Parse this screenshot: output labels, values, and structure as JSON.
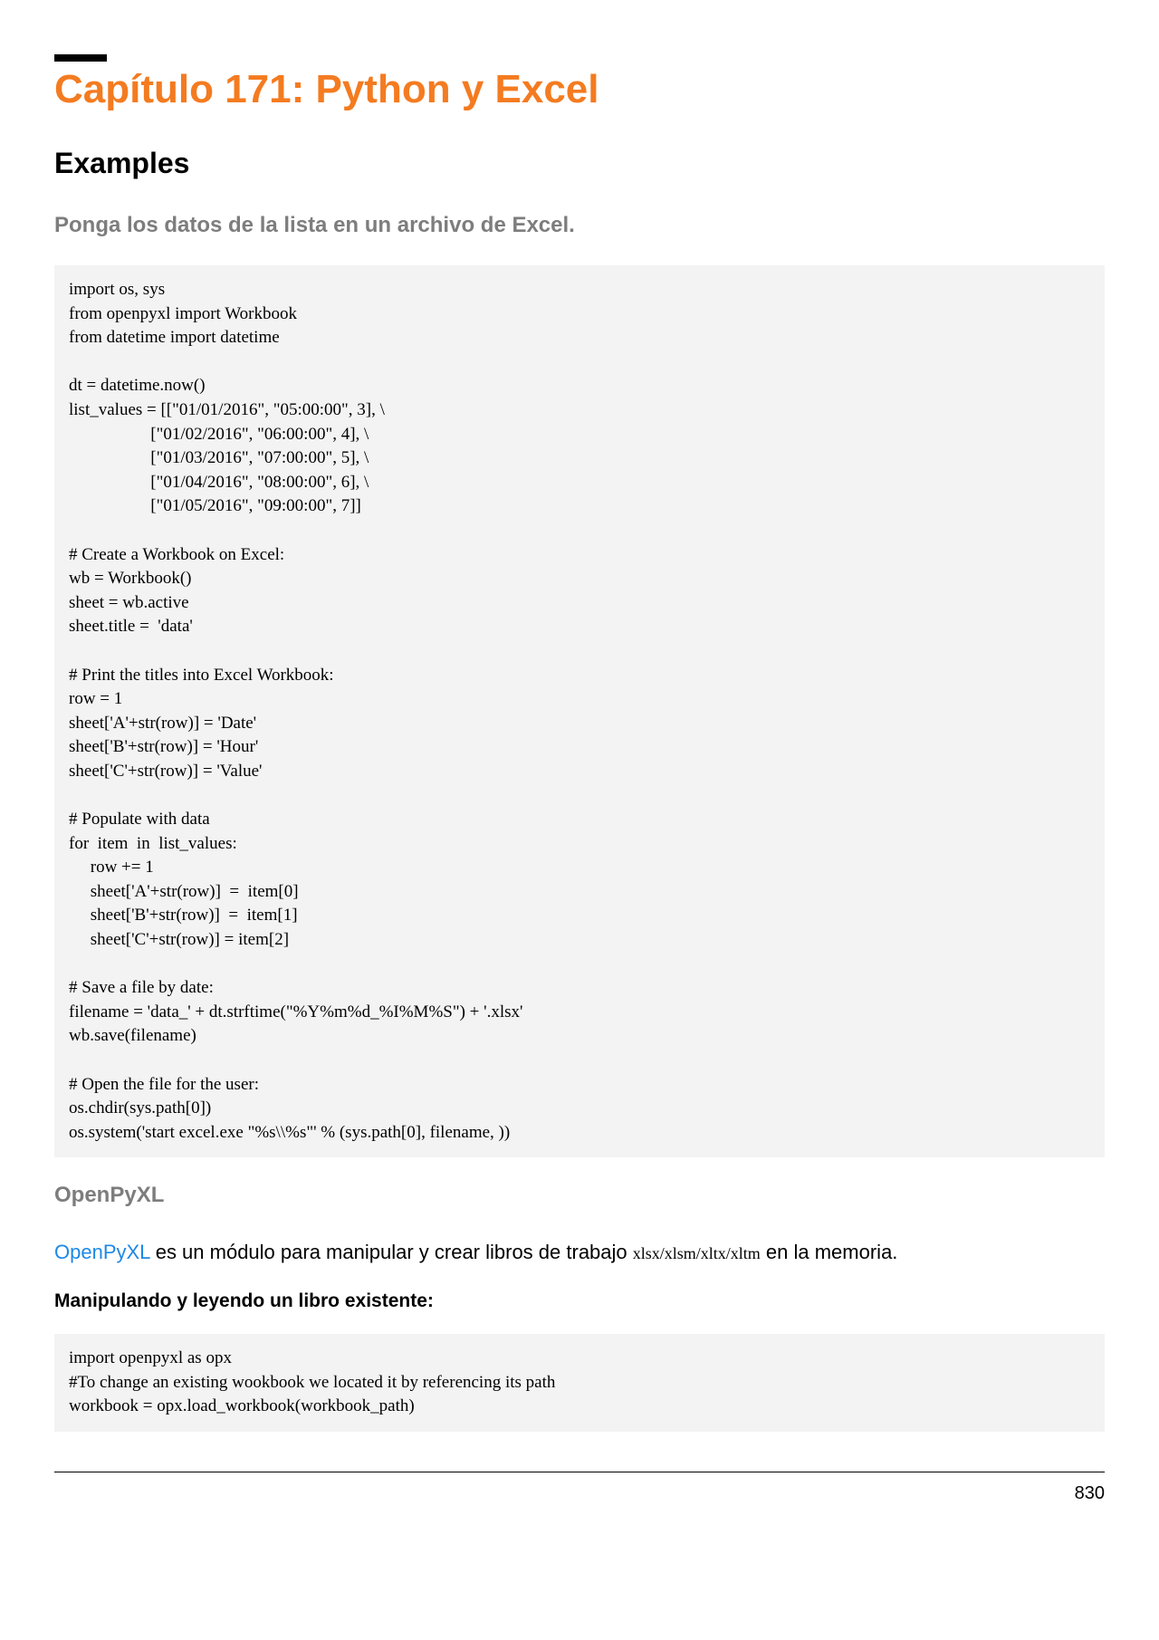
{
  "chapter": {
    "title": "Capítulo 171: Python y Excel"
  },
  "examples": {
    "heading": "Examples",
    "subtitle": "Ponga los datos de la lista en un archivo de Excel."
  },
  "code_block_1": "import os, sys\nfrom openpyxl import Workbook\nfrom datetime import datetime\n\ndt = datetime.now()\nlist_values = [[\"01/01/2016\", \"05:00:00\", 3], \\\n                   [\"01/02/2016\", \"06:00:00\", 4], \\\n                   [\"01/03/2016\", \"07:00:00\", 5], \\\n                   [\"01/04/2016\", \"08:00:00\", 6], \\\n                   [\"01/05/2016\", \"09:00:00\", 7]]\n\n# Create a Workbook on Excel:\nwb = Workbook()\nsheet = wb.active\nsheet.title =  'data'\n\n# Print the titles into Excel Workbook:\nrow = 1\nsheet['A'+str(row)] = 'Date'\nsheet['B'+str(row)] = 'Hour'\nsheet['C'+str(row)] = 'Value'\n\n# Populate with data\nfor  item  in  list_values:\n     row += 1\n     sheet['A'+str(row)]  =  item[0]\n     sheet['B'+str(row)]  =  item[1]\n     sheet['C'+str(row)] = item[2]\n\n# Save a file by date:\nfilename = 'data_' + dt.strftime(\"%Y%m%d_%I%M%S\") + '.xlsx'\nwb.save(filename)\n\n# Open the file for the user:\nos.chdir(sys.path[0])\nos.system('start excel.exe \"%s\\\\%s\"' % (sys.path[0], filename, ))",
  "openpyxl": {
    "heading": "OpenPyXL",
    "link_text": "OpenPyXL",
    "paragraph_part1": " es un módulo para manipular y crear libros de trabajo ",
    "inline_code": "xlsx/xlsm/xltx/xltm",
    "paragraph_part2": " en la memoria.",
    "sub_heading": "Manipulando y leyendo un libro existente:"
  },
  "code_block_2": "import openpyxl as opx\n#To change an existing wookbook we located it by referencing its path\nworkbook = opx.load_workbook(workbook_path)",
  "page_number": "830"
}
